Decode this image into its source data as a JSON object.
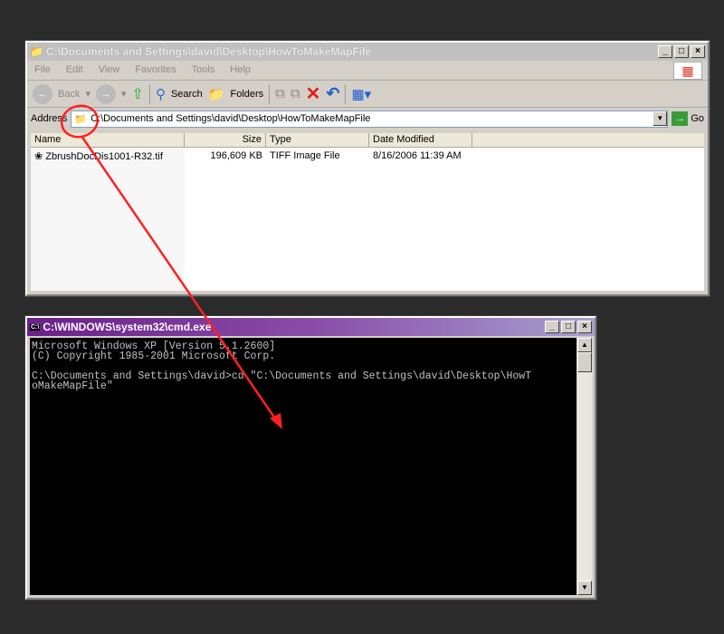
{
  "explorer": {
    "title": "C:\\Documents and Settings\\david\\Desktop\\HowToMakeMapFile",
    "menu": [
      "File",
      "Edit",
      "View",
      "Favorites",
      "Tools",
      "Help"
    ],
    "toolbar": {
      "back": "Back",
      "search": "Search",
      "folders": "Folders"
    },
    "address_label": "Address",
    "address_value": "C:\\Documents and Settings\\david\\Desktop\\HowToMakeMapFile",
    "go": "Go",
    "columns": [
      "Name",
      "Size",
      "Type",
      "Date Modified"
    ],
    "files": [
      {
        "name": "ZbrushDocDis1001-R32.tif",
        "size": "196,609 KB",
        "type": "TIFF Image File",
        "date": "8/16/2006 11:39 AM"
      }
    ]
  },
  "cmd": {
    "title": "C:\\WINDOWS\\system32\\cmd.exe",
    "lines": [
      "Microsoft Windows XP [Version 5.1.2600]",
      "(C) Copyright 1985-2001 Microsoft Corp.",
      "",
      "C:\\Documents and Settings\\david>cd \"C:\\Documents and Settings\\david\\Desktop\\HowT",
      "oMakeMapFile\""
    ]
  },
  "annotation_color": "#ff2020"
}
